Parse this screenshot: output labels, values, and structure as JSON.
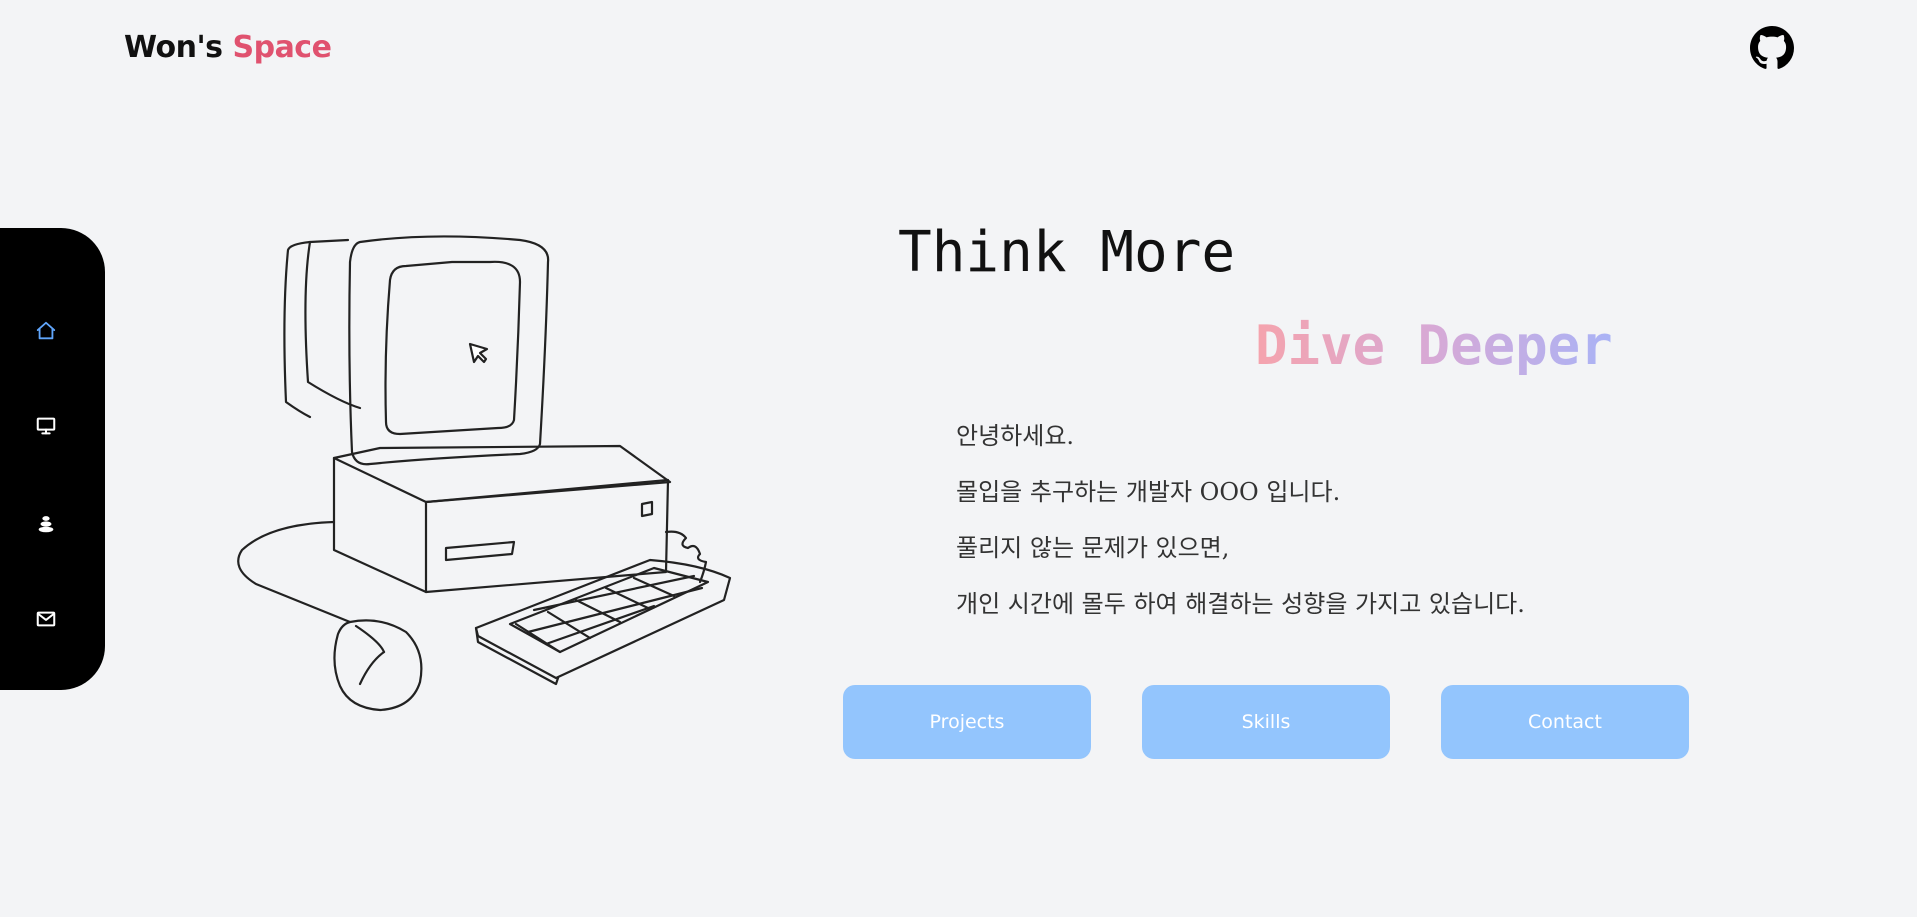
{
  "brand": {
    "name": "Won's",
    "accent": "Space",
    "accent_color": "#e0526f"
  },
  "header": {
    "github_icon": "github-icon"
  },
  "sidebar": {
    "items": [
      {
        "icon": "home-icon",
        "active": true,
        "color": "#60a5fa"
      },
      {
        "icon": "monitor-icon",
        "active": false,
        "color": "#ffffff"
      },
      {
        "icon": "stack-icon",
        "active": false,
        "color": "#ffffff"
      },
      {
        "icon": "mail-icon",
        "active": false,
        "color": "#ffffff"
      }
    ]
  },
  "hero": {
    "title": "Think More",
    "subtitle": "Dive Deeper",
    "subtitle_gradient": [
      "#f5a3ad",
      "#d7a9d6",
      "#a9b3f6"
    ],
    "intro": [
      "안녕하세요.",
      "몰입을 추구하는 개발자 OOO 입니다.",
      "풀리지 않는 문제가 있으면,",
      "개인 시간에 몰두 하여 해결하는 성향을 가지고 있습니다."
    ],
    "illustration_icon": "retro-computer-illustration"
  },
  "buttons": {
    "projects": "Projects",
    "skills": "Skills",
    "contact": "Contact",
    "color": "#93c5fd"
  }
}
